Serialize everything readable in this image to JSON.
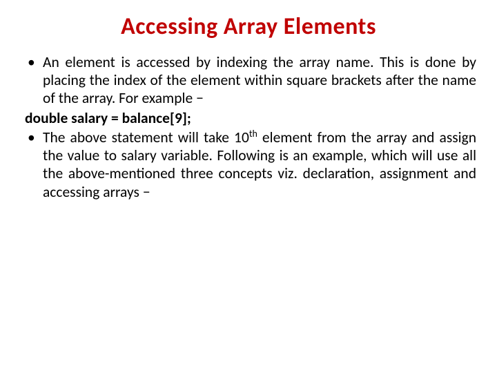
{
  "title": "Accessing Array Elements",
  "bullets": {
    "b1": "An element is accessed by indexing the array name. This is done by placing the index of the element within square brackets after the name of the array. For example −",
    "code": "double salary = balance[9];",
    "b2_pre": "The above statement will take 10",
    "b2_sup": "th",
    "b2_post": " element from the array and assign the value to salary variable. Following is an example, which will use all the above-mentioned three concepts viz. declaration, assignment and accessing arrays −"
  },
  "bullet_mark": "•"
}
